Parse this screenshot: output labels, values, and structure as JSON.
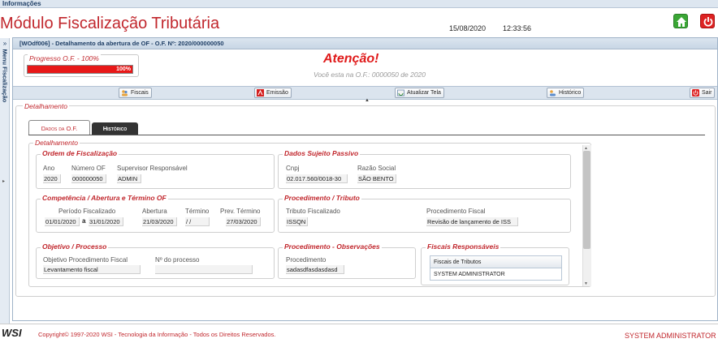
{
  "topbar": {
    "label": "Informações"
  },
  "header": {
    "title": "Módulo Fiscalização Tributária",
    "date": "15/08/2020",
    "time": "12:33:56"
  },
  "sidebar": {
    "toggle": "»",
    "label": "Menu Fiscalização",
    "arrow": "▸"
  },
  "window": {
    "title": "[WOdf006] - Detalhamento da abertura de OF - O.F. Nº: 2020/000000050"
  },
  "progress": {
    "label": "Progresso O.F. - 100%",
    "value_text": "100%",
    "percent": 100,
    "color": "#e81818"
  },
  "attention": {
    "title": "Atenção!",
    "message": "Você esta na O.F.: 0000050 de 2020"
  },
  "toolbar": {
    "fiscais": "Fiscais",
    "emissao": "Emissão",
    "atualizar": "Atualizar Tela",
    "historico": "Histórico",
    "sair": "Sair",
    "caret": "▲"
  },
  "detalhamento": {
    "label": "Detalhamento"
  },
  "tabs": {
    "dados": "Dados da O.F.",
    "historico": "Histórico"
  },
  "inner": {
    "label": "Detalhamento"
  },
  "ordem": {
    "label": "Ordem de Fiscalização",
    "ano_label": "Ano",
    "ano": "2020",
    "numero_label": "Número OF",
    "numero": "000000050",
    "supervisor_label": "Supervisor Responsável",
    "supervisor": "ADMIN"
  },
  "sujeito": {
    "label": "Dados Sujeito Passivo",
    "cnpj_label": "Cnpj",
    "cnpj": "02.017.560/0018-30",
    "razao_label": "Razão Social",
    "razao": "SÃO BENTO"
  },
  "competencia": {
    "label": "Competência / Abertura e Término OF",
    "periodo_label": "Período Fiscalizado",
    "periodo_inicio": "01/01/2020",
    "periodo_sep": "a",
    "periodo_fim": "31/01/2020",
    "abertura_label": "Abertura",
    "abertura": "21/03/2020",
    "termino_label": "Término",
    "termino": "/ /",
    "prev_label": "Prev. Término",
    "prev": "27/03/2020"
  },
  "procedimento": {
    "label": "Procedimento / Tributo",
    "tributo_label": "Tributo Fiscalizado",
    "tributo": "ISSQN",
    "proc_label": "Procedimento Fiscal",
    "proc": "Revisão de lançamento de ISS"
  },
  "objetivo": {
    "label": "Objetivo / Processo",
    "obj_label": "Objetivo Procedimento Fiscal",
    "obj": "Levantamento fiscal",
    "nproc_label": "Nº do processo",
    "nproc": ""
  },
  "observacoes": {
    "label": "Procedimento - Observações",
    "proc_label": "Procedimento",
    "proc": "sadasdfasdasdasd"
  },
  "fiscais": {
    "label": "Fiscais Responsáveis",
    "header": "Fiscais de Tributos",
    "rows": [
      "SYSTEM ADMINISTRATOR"
    ]
  },
  "footer": {
    "logo": "WSI",
    "copyright": "Copyright© 1997-2020 WSI - Tecnologia da Informação - Todos os Direitos Reservados.",
    "user": "SYSTEM ADMINISTRATOR"
  }
}
